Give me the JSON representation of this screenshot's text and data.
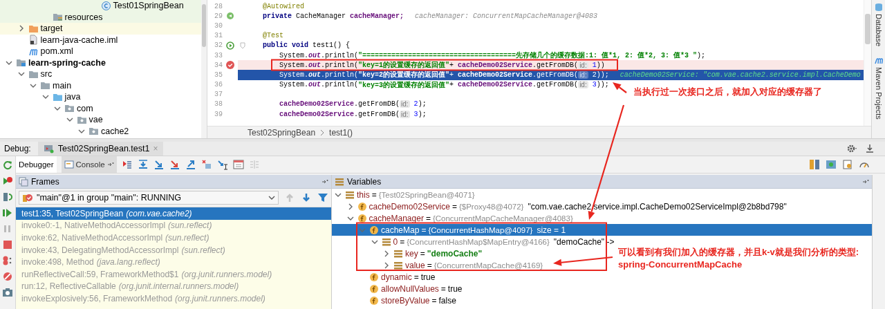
{
  "project_tree": {
    "items": [
      {
        "children": [
          {
            "children": [
              {
                "children": [
                  {
                    "children": [
                      {
                        "children": [
                          {
                            "children": [
                              {
                                "children": [
                                  {
                                    "label": "Test01SpringBean",
                                    "kind": "class",
                                    "color": "#edf6e6"
                                  }
                                ]
                              }
                            ]
                          }
                        ]
                      }
                    ]
                  },
                  {
                    "label": "resources",
                    "kind": "resources",
                    "color": "#edf6e6"
                  }
                ]
              }
            ]
          },
          {
            "label": "target",
            "kind": "folder-excluded",
            "color": "#fbfae4",
            "expanded": false
          },
          {
            "label": "learn-java-cache.iml",
            "kind": "file"
          },
          {
            "label": "pom.xml",
            "kind": "xml"
          }
        ]
      },
      {
        "label": "learn-spring-cache",
        "kind": "module",
        "bold": true,
        "expanded": true,
        "children": [
          {
            "label": "src",
            "kind": "folder",
            "expanded": true,
            "children": [
              {
                "label": "main",
                "kind": "folder",
                "expanded": true,
                "children": [
                  {
                    "label": "java",
                    "kind": "source-folder",
                    "expanded": true,
                    "children": [
                      {
                        "label": "com",
                        "kind": "package",
                        "expanded": true,
                        "children": [
                          {
                            "label": "vae",
                            "kind": "package",
                            "expanded": true,
                            "children": [
                              {
                                "label": "cache2",
                                "kind": "package",
                                "expanded": true
                              }
                            ]
                          }
                        ]
                      }
                    ]
                  }
                ]
              }
            ]
          }
        ]
      }
    ]
  },
  "editor": {
    "lines": [
      {
        "number": "28",
        "kind": "member",
        "breakpoint": false,
        "current": false,
        "tokens": [
          {
            "kind": "ann",
            "text": "@Autowired"
          }
        ]
      },
      {
        "number": "29",
        "kind": "member",
        "breakpoint": false,
        "current": false,
        "gutter_icon": {
          "kind": "bean"
        },
        "tokens": [
          {
            "kind": "kw",
            "text": "private"
          },
          {
            "kind": "t",
            "text": "CacheManager"
          },
          {
            "kind": "var",
            "text": "cacheManager;"
          },
          {
            "kind": "inline",
            "text": "cacheManager: ConcurrentMapCacheManager@4083"
          }
        ]
      },
      {
        "number": "30",
        "breakpoint": false,
        "current": false
      },
      {
        "number": "31",
        "kind": "member",
        "breakpoint": false,
        "current": false,
        "tokens": [
          {
            "kind": "ann",
            "text": "@Test"
          }
        ]
      },
      {
        "number": "32",
        "kind": "member",
        "breakpoint": false,
        "current": false,
        "gutter_icon": {
          "kind": "run"
        },
        "foldable": true,
        "tokens": [
          {
            "kind": "kw",
            "text": "public void"
          },
          {
            "kind": "t",
            "text": "test1() {"
          }
        ]
      },
      {
        "number": "33",
        "kind": "statement",
        "breakpoint": false,
        "current": false,
        "tokens": [
          {
            "kind": "t",
            "text": "System."
          },
          {
            "kind": "field",
            "text": "out"
          },
          {
            "kind": "t",
            "text": ".println("
          },
          {
            "kind": "str",
            "text": "\"=====================================先存储几个的缓存数据:1: 值*1, 2: 值*2, 3: 值*3 \""
          },
          {
            "kind": "t",
            "text": ");"
          }
        ]
      },
      {
        "number": "34",
        "kind": "statement",
        "breakpoint": true,
        "current": false,
        "tokens": [
          {
            "kind": "t",
            "text": "System."
          },
          {
            "kind": "field",
            "text": "out"
          },
          {
            "kind": "t",
            "text": ".println("
          },
          {
            "kind": "str",
            "text": "\"key=1的设置缓存的返回值\""
          },
          {
            "kind": "t",
            "text": "+"
          },
          {
            "kind": "var",
            "text": "cacheDemo02Service"
          },
          {
            "kind": "t",
            "text": ".getFromDB("
          },
          {
            "kind": "hint",
            "text": "id:"
          },
          {
            "kind": "num",
            "text": "1"
          },
          {
            "kind": "t",
            "text": "))"
          }
        ]
      },
      {
        "number": "35",
        "kind": "statement",
        "breakpoint": false,
        "current": true,
        "tokens": [
          {
            "kind": "t",
            "text": "System."
          },
          {
            "kind": "field",
            "text": "out"
          },
          {
            "kind": "t",
            "text": ".println("
          },
          {
            "kind": "str",
            "text": "\"key=2的设置缓存的返回值\""
          },
          {
            "kind": "t",
            "text": "+"
          },
          {
            "kind": "var",
            "text": "cacheDemo02Service"
          },
          {
            "kind": "t",
            "text": ".getFromDB("
          },
          {
            "kind": "hint",
            "text": "id:"
          },
          {
            "kind": "num",
            "text": "2"
          },
          {
            "kind": "t",
            "text": "));"
          },
          {
            "kind": "inline",
            "text": "cacheDemo02Service: \"com.vae.cache2.service.impl.CacheDemo"
          }
        ]
      },
      {
        "number": "36",
        "kind": "statement",
        "breakpoint": false,
        "current": false,
        "tokens": [
          {
            "kind": "t",
            "text": "System."
          },
          {
            "kind": "field",
            "text": "out"
          },
          {
            "kind": "t",
            "text": ".println("
          },
          {
            "kind": "str",
            "text": "\"key=3的设置缓存的返回值\""
          },
          {
            "kind": "t",
            "text": "+"
          },
          {
            "kind": "var",
            "text": "cacheDemo02Service"
          },
          {
            "kind": "t",
            "text": ".getFromDB("
          },
          {
            "kind": "hint",
            "text": "id:"
          },
          {
            "kind": "num",
            "text": "3"
          },
          {
            "kind": "t",
            "text": "));"
          }
        ]
      },
      {
        "number": "37",
        "breakpoint": false,
        "current": false
      },
      {
        "number": "38",
        "kind": "statement",
        "breakpoint": false,
        "current": false,
        "tokens": [
          {
            "kind": "var",
            "text": "cacheDemo02Service"
          },
          {
            "kind": "t",
            "text": ".getFromDB("
          },
          {
            "kind": "hint",
            "text": "id:"
          },
          {
            "kind": "num",
            "text": "2"
          },
          {
            "kind": "t",
            "text": ");"
          }
        ]
      },
      {
        "number": "39",
        "kind": "statement",
        "breakpoint": false,
        "current": false,
        "tokens": [
          {
            "kind": "var",
            "text": "cacheDemo02Service"
          },
          {
            "kind": "t",
            "text": ".getFromDB("
          },
          {
            "kind": "hint",
            "text": "id:"
          },
          {
            "kind": "num",
            "text": "3"
          },
          {
            "kind": "t",
            "text": ");"
          }
        ]
      }
    ],
    "breadcrumbs": [
      "Test02SpringBean",
      "test1()"
    ]
  },
  "side_tools": [
    {
      "label": "Database",
      "kind": "database"
    },
    {
      "label": "Maven Projects",
      "kind": "maven"
    }
  ],
  "debug": {
    "label": "Debug:",
    "session_tab": {
      "title": "Test02SpringBean.test1",
      "close": "×"
    },
    "tabs": [
      {
        "label": "Debugger",
        "selected": true
      },
      {
        "label": "Console",
        "selected": false
      }
    ],
    "frames": {
      "title": "Frames",
      "thread": "\"main\"@1 in group \"main\": RUNNING",
      "items": [
        {
          "method": "test1:35, Test02SpringBean",
          "package": "(com.vae.cache2)",
          "selected": true
        },
        {
          "method": "invoke0:-1, NativeMethodAccessorImpl",
          "package": "(sun.reflect)",
          "selected": false
        },
        {
          "method": "invoke:62, NativeMethodAccessorImpl",
          "package": "(sun.reflect)",
          "selected": false
        },
        {
          "method": "invoke:43, DelegatingMethodAccessorImpl",
          "package": "(sun.reflect)",
          "selected": false
        },
        {
          "method": "invoke:498, Method",
          "package": "(java.lang.reflect)",
          "selected": false
        },
        {
          "method": "runReflectiveCall:59, FrameworkMethod$1",
          "package": "(org.junit.runners.model)",
          "selected": false
        },
        {
          "method": "run:12, ReflectiveCallable",
          "package": "(org.junit.internal.runners.model)",
          "selected": false
        },
        {
          "method": "invokeExplosively:56, FrameworkMethod",
          "package": "(org.junit.runners.model)",
          "selected": false
        }
      ]
    },
    "variables": {
      "title": "Variables",
      "items": [
        {
          "kind": "object",
          "name": "this",
          "separator": "=",
          "value": {
            "kind": "ref",
            "text": "{Test02SpringBean@4071}"
          },
          "expanded": true,
          "selected": false,
          "children": [
            {
              "kind": "field",
              "name": "cacheDemo02Service",
              "separator": "=",
              "value": {
                "kind": "ref",
                "text": "{$Proxy48@4072}"
              },
              "extra": "\"com.vae.cache2.service.impl.CacheDemo02ServiceImpl@2b8bd798\"",
              "expanded": false,
              "selected": false
            },
            {
              "kind": "field",
              "name": "cacheManager",
              "separator": "=",
              "value": {
                "kind": "ref",
                "text": "{ConcurrentMapCacheManager@4083}"
              },
              "expanded": true,
              "selected": false,
              "children": [
                {
                  "kind": "field",
                  "name": "cacheMap",
                  "separator": "=",
                  "value": {
                    "kind": "ref",
                    "text": "{ConcurrentHashMap@4097}"
                  },
                  "extra": "size = 1",
                  "expanded": true,
                  "selected": true,
                  "children": [
                    {
                      "kind": "object",
                      "name": "0",
                      "separator": "=",
                      "value": {
                        "kind": "ref",
                        "text": "{ConcurrentHashMap$MapEntry@4166}"
                      },
                      "extra": "\"demoCache\" ->",
                      "expanded": true,
                      "selected": false,
                      "children": [
                        {
                          "kind": "object",
                          "name": "key",
                          "separator": "=",
                          "value": {
                            "kind": "string",
                            "text": "\"demoCache\""
                          },
                          "expanded": false,
                          "selected": false
                        },
                        {
                          "kind": "object",
                          "name": "value",
                          "separator": "=",
                          "value": {
                            "kind": "ref",
                            "text": "{ConcurrentMapCache@4169}"
                          },
                          "expanded": false,
                          "selected": false
                        }
                      ]
                    }
                  ]
                },
                {
                  "kind": "field",
                  "name": "dynamic",
                  "separator": "=",
                  "value": {
                    "kind": "literal",
                    "text": "true"
                  },
                  "selected": false
                },
                {
                  "kind": "field",
                  "name": "allowNullValues",
                  "separator": "=",
                  "value": {
                    "kind": "literal",
                    "text": "true"
                  },
                  "selected": false
                },
                {
                  "kind": "field",
                  "name": "storeByValue",
                  "separator": "=",
                  "value": {
                    "kind": "literal",
                    "text": "false"
                  },
                  "selected": false
                }
              ]
            }
          ]
        }
      ]
    }
  },
  "annotations": [
    {
      "lines": [
        "当执行过一次接口之后，就加入对应的缓存器了"
      ]
    },
    {
      "lines": [
        "可以看到有我们加入的缓存器，并且k-v就是我们分析的类型:",
        "spring-ConcurrentMapCache"
      ]
    }
  ]
}
